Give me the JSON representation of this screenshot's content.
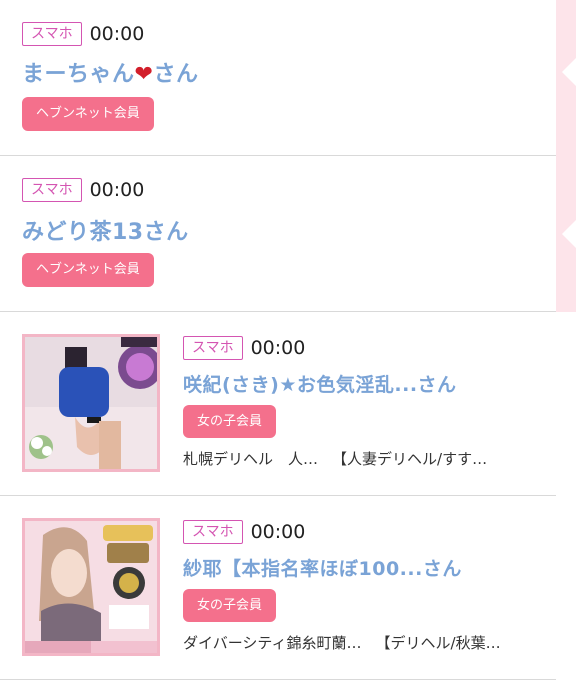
{
  "entries": [
    {
      "device": "スマホ",
      "time": "00:00",
      "name_main": "まーちゃん",
      "name_emoji": "❤",
      "name_suffix": "さん",
      "member": "ヘブンネット会員"
    },
    {
      "device": "スマホ",
      "time": "00:00",
      "name_main": "みどり茶13",
      "name_suffix": "さん",
      "member": "ヘブンネット会員"
    },
    {
      "device": "スマホ",
      "time": "00:00",
      "name_main": "咲紀(さき)★お色気淫乱...さん",
      "member": "女の子会員",
      "shop_area": "札幌デリヘル　人…",
      "shop_name": "【人妻デリヘル/すす…"
    },
    {
      "device": "スマホ",
      "time": "00:00",
      "name_main": "紗耶【本指名率ほぼ100...さん",
      "member": "女の子会員",
      "shop_area": "ダイバーシティ錦糸町蘭…",
      "shop_name": "【デリヘル/秋葉…"
    }
  ],
  "colors": {
    "accent_blue": "#7aa3d6",
    "badge_pink": "#f4708c",
    "device_magenta": "#d455b2",
    "side_strip": "#fde4ea"
  }
}
